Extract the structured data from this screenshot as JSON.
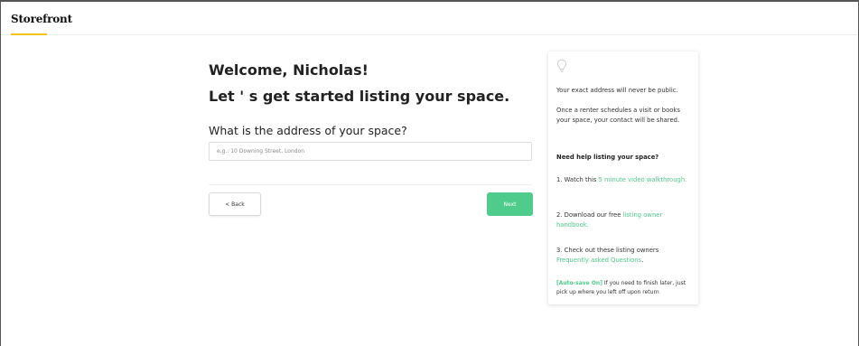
{
  "app": {
    "logo": "Storefront",
    "accent_color": "#f0c419",
    "brand_green": "#4fcb8c"
  },
  "main": {
    "welcome": "Welcome, Nicholas!",
    "subtitle": "Let ' s get started listing your space.",
    "question": "What is the address of your space?",
    "address_placeholder": "e.g.: 10 Downing Street, London",
    "address_value": "",
    "back_label": "< Back",
    "next_label": "Next"
  },
  "help": {
    "icon": "lightbulb-icon",
    "privacy_note": "Your exact address will never be public.",
    "contact_note": "Once a renter schedules a visit or books your space, your contact will be shared.",
    "heading": "Need help listing your space?",
    "step1_prefix": "1. Watch this ",
    "step1_link": "5 minute video walkthrough.",
    "step2_prefix": "2. Download our free ",
    "step2_link": "listing owner handbook.",
    "step3_prefix": "3. Check out these listing owners ",
    "step3_link": "Frequently asked Questions",
    "step3_suffix": ".",
    "autosave_label": "[Auto-save On]",
    "autosave_text": " If you need to finish later, just pick up where you left off upon return"
  }
}
